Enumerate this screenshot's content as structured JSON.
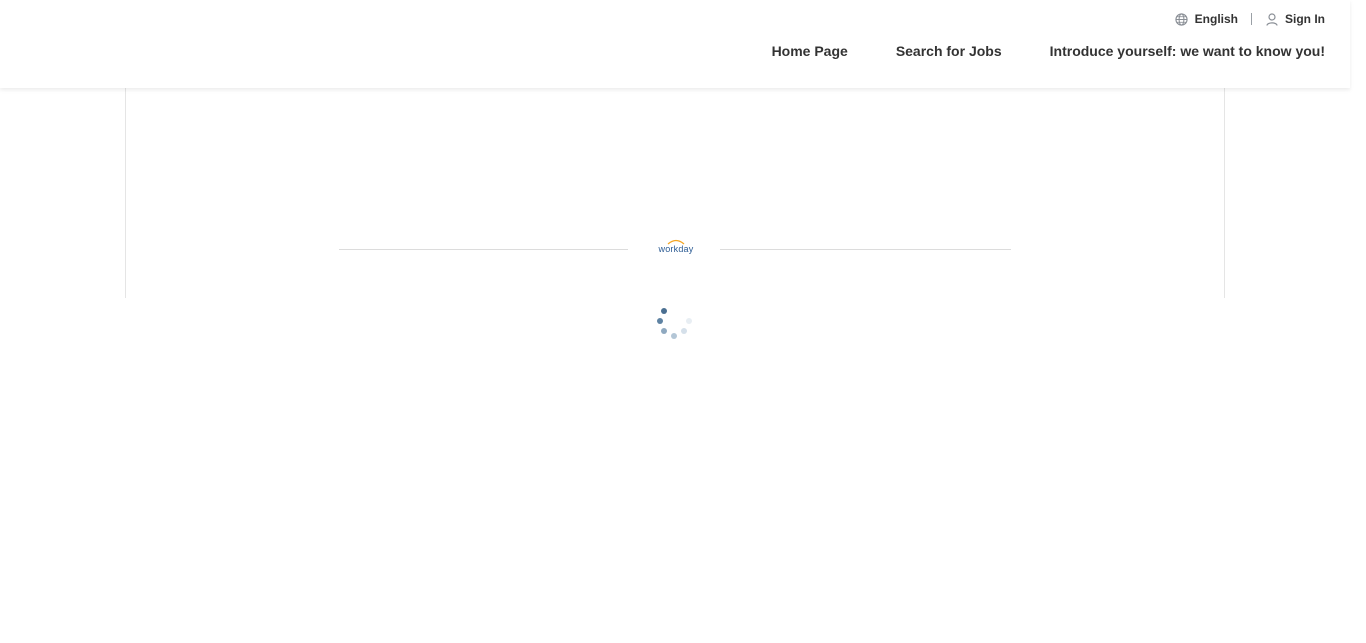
{
  "header": {
    "language_label": "English",
    "signin_label": "Sign In",
    "nav": [
      {
        "label": "Home Page"
      },
      {
        "label": "Search for Jobs"
      },
      {
        "label": "Introduce yourself: we want to know you!"
      }
    ]
  },
  "loading": {
    "logo_text": "workday"
  },
  "colors": {
    "text": "#333333",
    "logo_blue": "#2b5b93",
    "logo_orange": "#f5a623",
    "spinner_dark": "#4a6f91",
    "spinner_light": "#c9d6e2"
  },
  "icons": {
    "language": "globe-icon",
    "signin": "user-icon",
    "loading": "spinner-icon"
  }
}
